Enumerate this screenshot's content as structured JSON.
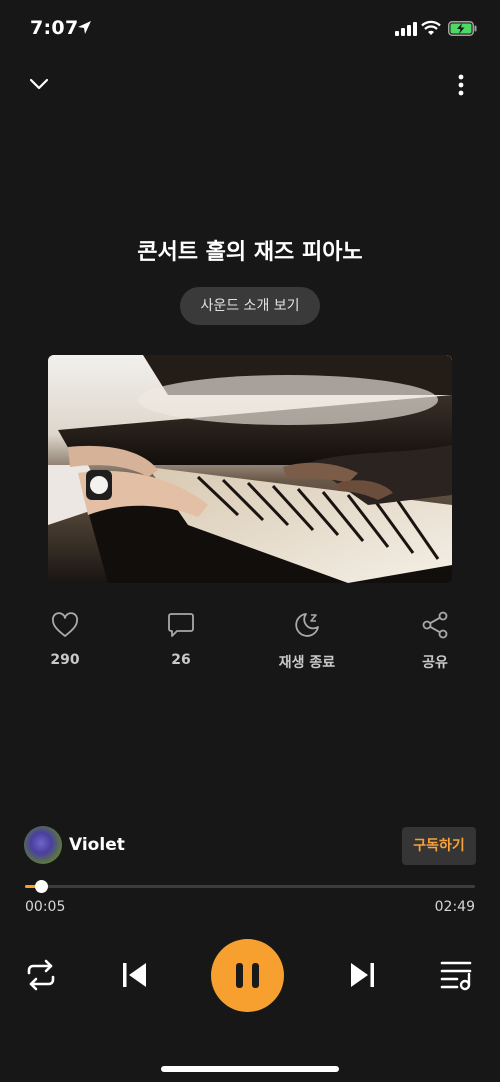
{
  "status_bar": {
    "time": "7:07"
  },
  "nav": {
    "back_icon": "chevron-down-icon",
    "more_icon": "more-vertical-icon"
  },
  "track": {
    "title": "콘서트 홀의 재즈 피아노",
    "sound_intro_label": "사운드 소개 보기"
  },
  "actions": {
    "like_count": "290",
    "comment_count": "26",
    "sleep_timer_label": "재생 종료",
    "share_label": "공유"
  },
  "artist": {
    "name": "Violet",
    "subscribe_label": "구독하기"
  },
  "player": {
    "elapsed": "00:05",
    "total": "02:49",
    "progress_fraction": 0.035,
    "state": "playing"
  },
  "colors": {
    "accent": "#f7a02f",
    "background": "#171717"
  }
}
